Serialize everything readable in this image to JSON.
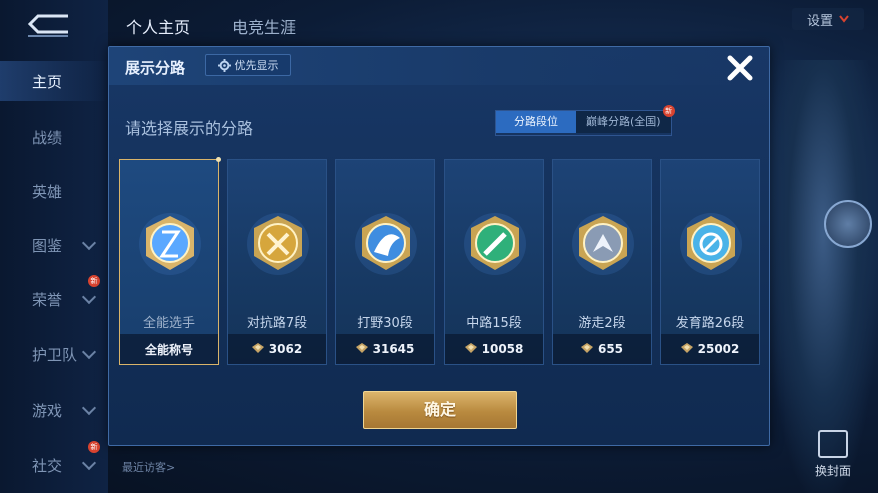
{
  "top_tabs": [
    "个人主页",
    "电竞生涯"
  ],
  "settings_label": "设置",
  "sidebar": {
    "items": [
      {
        "label": "主页",
        "active": true,
        "chevron": false,
        "new": false
      },
      {
        "label": "战绩",
        "active": false,
        "chevron": false,
        "new": false
      },
      {
        "label": "英雄",
        "active": false,
        "chevron": false,
        "new": false
      },
      {
        "label": "图鉴",
        "active": false,
        "chevron": true,
        "new": false
      },
      {
        "label": "荣誉",
        "active": false,
        "chevron": true,
        "new": true
      },
      {
        "label": "护卫队",
        "active": false,
        "chevron": true,
        "new": false
      },
      {
        "label": "游戏",
        "active": false,
        "chevron": true,
        "new": false
      },
      {
        "label": "社交",
        "active": false,
        "chevron": true,
        "new": true
      }
    ],
    "new_badge": "新"
  },
  "bottom_hint": "最近访客>",
  "cover_label": "换封面",
  "modal": {
    "title": "展示分路",
    "priority_label": "优先显示",
    "subtitle": "请选择展示的分路",
    "segments": [
      {
        "label": "分路段位",
        "active": true
      },
      {
        "label": "巅峰分路(全国)",
        "active": false,
        "new": true
      }
    ],
    "cards": [
      {
        "name": "全能选手",
        "bottom": "全能称号",
        "selected": true,
        "icon": "all-round-badge-icon",
        "color": "#5aa8ff"
      },
      {
        "name": "对抗路7段",
        "value": "3062",
        "selected": false,
        "icon": "clash-lane-badge-icon",
        "color": "#d6a63c"
      },
      {
        "name": "打野30段",
        "value": "31645",
        "selected": false,
        "icon": "jungle-badge-icon",
        "color": "#3f8de0"
      },
      {
        "name": "中路15段",
        "value": "10058",
        "selected": false,
        "icon": "mid-lane-badge-icon",
        "color": "#2fb07a"
      },
      {
        "name": "游走2段",
        "value": "655",
        "selected": false,
        "icon": "roam-badge-icon",
        "color": "#8a9bb4"
      },
      {
        "name": "发育路26段",
        "value": "25002",
        "selected": false,
        "icon": "farm-lane-badge-icon",
        "color": "#4ab3e8"
      }
    ],
    "confirm_label": "确定"
  },
  "colors": {
    "gold": "#d9b46a",
    "accent": "#2c6bc0",
    "new_badge": "#d8432f"
  }
}
